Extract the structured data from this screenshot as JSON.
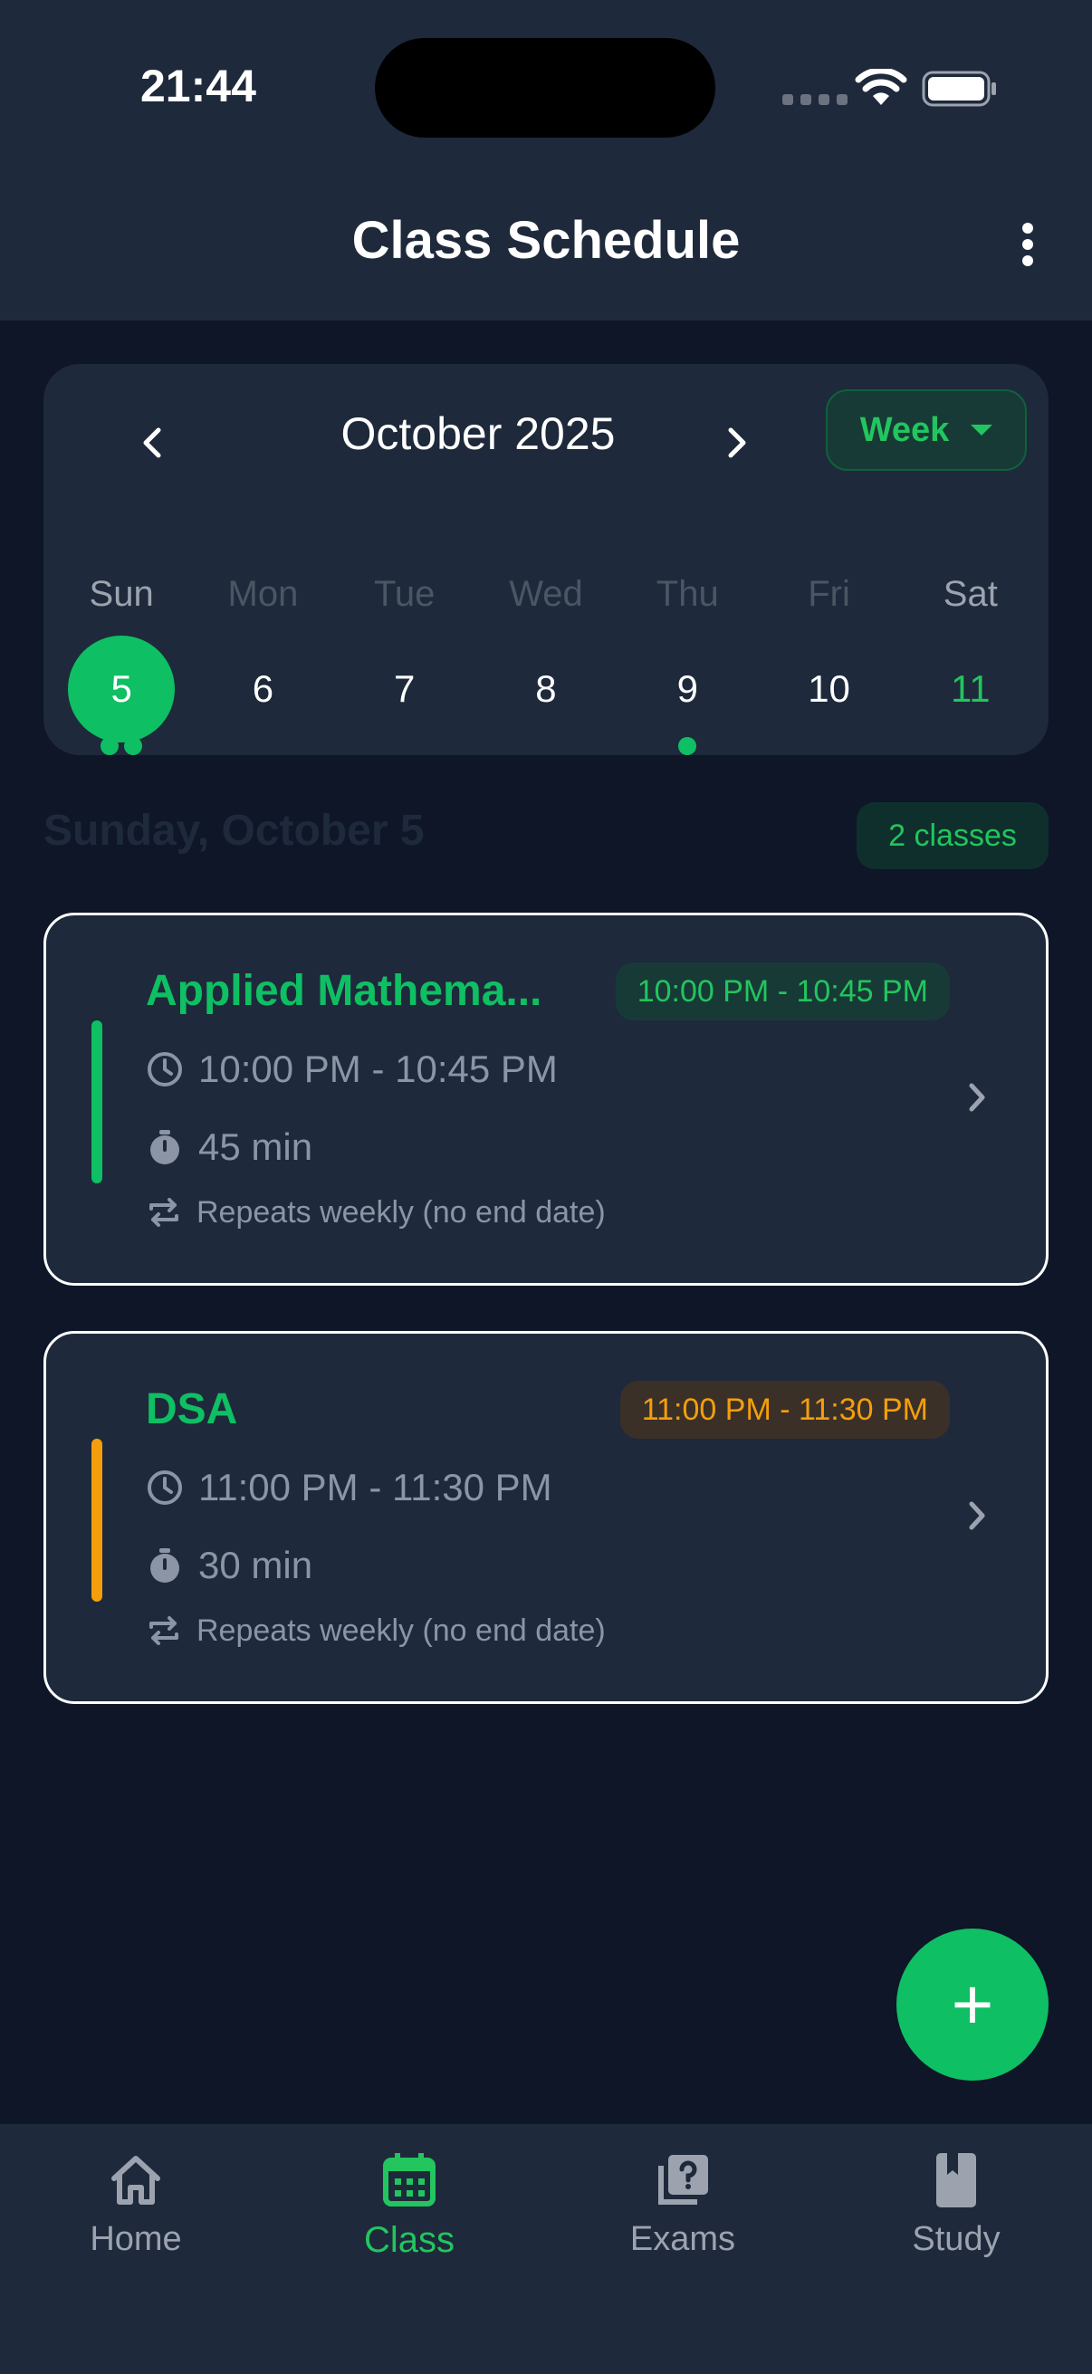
{
  "status": {
    "time": "21:44"
  },
  "header": {
    "title": "Class Schedule"
  },
  "calendar": {
    "month": "October 2025",
    "view": "Week",
    "weekdays": [
      "Sun",
      "Mon",
      "Tue",
      "Wed",
      "Thu",
      "Fri",
      "Sat"
    ],
    "days": [
      "5",
      "6",
      "7",
      "8",
      "9",
      "10",
      "11"
    ]
  },
  "selected_date": {
    "label": "Sunday, October 5",
    "count": "2 classes"
  },
  "classes": [
    {
      "title": "Applied Mathema...",
      "badge": "10:00 PM - 10:45 PM",
      "time": "10:00 PM - 10:45 PM",
      "duration": "45 min",
      "repeat": "Repeats weekly (no end date)",
      "accent": "#0fbf63"
    },
    {
      "title": "DSA",
      "badge": "11:00 PM - 11:30 PM",
      "time": "11:00 PM - 11:30 PM",
      "duration": "30 min",
      "repeat": "Repeats weekly (no end date)",
      "accent": "#f59e0b"
    }
  ],
  "fab": {
    "label": "+"
  },
  "nav": [
    {
      "label": "Home",
      "icon": "home-icon"
    },
    {
      "label": "Class",
      "icon": "calendar-icon"
    },
    {
      "label": "Exams",
      "icon": "question-icon"
    },
    {
      "label": "Study",
      "icon": "book-icon"
    }
  ],
  "colors": {
    "accent": "#0fbf63",
    "accent_orange": "#f59e0b",
    "background": "#0e1628",
    "surface": "#1e293b"
  }
}
